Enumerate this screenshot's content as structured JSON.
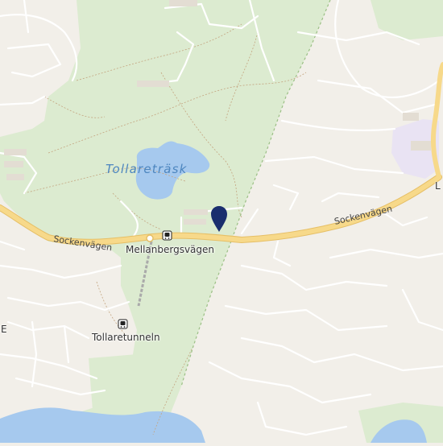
{
  "map": {
    "lake_label": "Tollareträsk",
    "roads": {
      "main_road_west": "Sockenvägen",
      "main_road_east": "Sockenvägen"
    },
    "stops": [
      {
        "label": "Mellanbergsvägen",
        "icon": "bus-stop-icon"
      },
      {
        "label": "Tollaretunneln",
        "icon": "bus-stop-icon"
      }
    ],
    "edge_labels": {
      "left": "E",
      "right": "L"
    },
    "marker_icon": "location-pin-icon",
    "colors": {
      "land": "#f2efe9",
      "park": "#dcebd0",
      "water": "#a6c9ee",
      "main_road": "#f7d98a",
      "marker": "#1a2e6e",
      "school": "#e9e3f3"
    }
  }
}
